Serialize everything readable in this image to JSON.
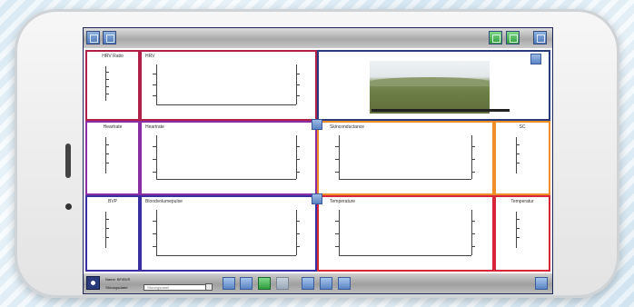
{
  "panels": {
    "hrv_ratio": {
      "title": "HRV Ratio"
    },
    "hrv": {
      "title": "HRV"
    },
    "heartrate_small": {
      "title": "Heartrate"
    },
    "heartrate": {
      "title": "Heartrate"
    },
    "skinconductance": {
      "title": "Skinconductance"
    },
    "sc": {
      "title": "SC"
    },
    "bvp_small": {
      "title": "BVP"
    },
    "blood_volume_pulse": {
      "title": "Bloodvolumepulse"
    },
    "temperature": {
      "title": "Temperature"
    },
    "temperature_small": {
      "title": "Temperatur"
    }
  },
  "bottom_bar": {
    "name_label": "Name: BF/BVR",
    "session_label": "Sitzungsdatei:",
    "session_placeholder": "Sitzungsdatei"
  },
  "colors": {
    "hrv_border": "#b0214a",
    "heart_border": "#8a2ea4",
    "skin_border": "#ef8d28",
    "bvp_border": "#3a2fa0",
    "temp_border": "#d6263a",
    "frame_blue": "#2a3c7c"
  },
  "icons": [
    "app-logo-icon",
    "grid-icon",
    "window-icon",
    "green-icon",
    "green-icon",
    "menu-icon",
    "chart-icon",
    "image-icon",
    "record-icon",
    "stop-icon",
    "export-icon",
    "settings-icon",
    "share-icon",
    "exit-icon"
  ]
}
